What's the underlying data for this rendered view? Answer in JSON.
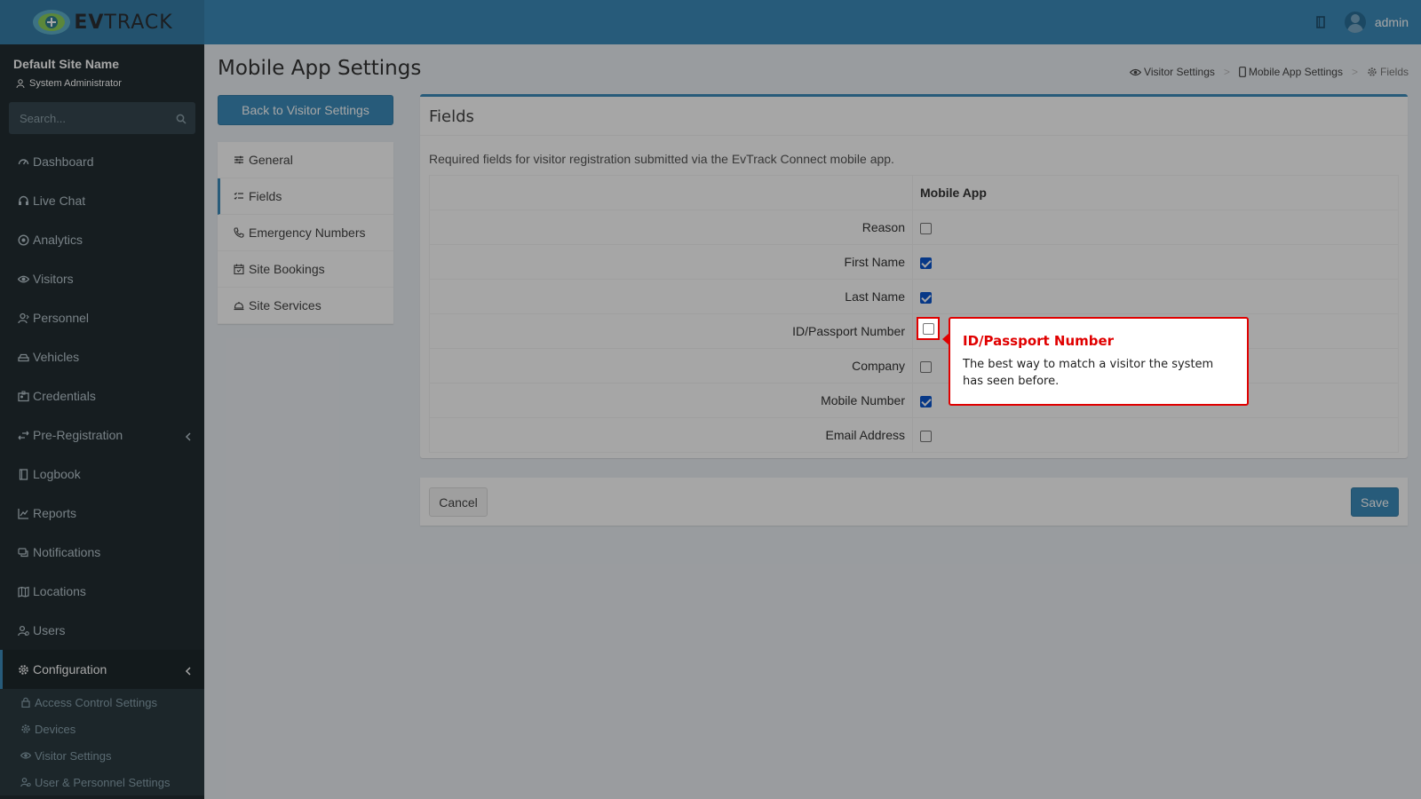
{
  "header": {
    "logo_text_bold": "EV",
    "logo_text": "TRACK",
    "user_name": "admin"
  },
  "sidebar": {
    "site_name": "Default Site Name",
    "role": "System Administrator",
    "search_placeholder": "Search...",
    "items": [
      {
        "label": "Dashboard",
        "icon": "dashboard-icon"
      },
      {
        "label": "Live Chat",
        "icon": "headset-icon"
      },
      {
        "label": "Analytics",
        "icon": "target-icon"
      },
      {
        "label": "Visitors",
        "icon": "eye-icon"
      },
      {
        "label": "Personnel",
        "icon": "user-tie-icon"
      },
      {
        "label": "Vehicles",
        "icon": "car-icon"
      },
      {
        "label": "Credentials",
        "icon": "id-card-icon"
      },
      {
        "label": "Pre-Registration",
        "icon": "exchange-icon"
      },
      {
        "label": "Logbook",
        "icon": "book-icon"
      },
      {
        "label": "Reports",
        "icon": "chart-icon"
      },
      {
        "label": "Notifications",
        "icon": "comments-icon"
      },
      {
        "label": "Locations",
        "icon": "map-icon"
      },
      {
        "label": "Users",
        "icon": "users-icon"
      },
      {
        "label": "Configuration",
        "icon": "cog-icon"
      }
    ],
    "sub_items": [
      {
        "label": "Access Control Settings",
        "icon": "lock-icon"
      },
      {
        "label": "Devices",
        "icon": "gear-icon"
      },
      {
        "label": "Visitor Settings",
        "icon": "eye-icon"
      },
      {
        "label": "User & Personnel Settings",
        "icon": "users-icon"
      }
    ]
  },
  "page": {
    "title": "Mobile App Settings",
    "breadcrumb": [
      "Visitor Settings",
      "Mobile App Settings",
      "Fields"
    ],
    "back_button": "Back to Visitor Settings"
  },
  "settings_menu": [
    "General",
    "Fields",
    "Emergency Numbers",
    "Site Bookings",
    "Site Services"
  ],
  "fields_box": {
    "title": "Fields",
    "description": "Required fields for visitor registration submitted via the EvTrack Connect mobile app.",
    "column_header": "Mobile App",
    "rows": [
      {
        "label": "Reason",
        "checked": false
      },
      {
        "label": "First Name",
        "checked": true
      },
      {
        "label": "Last Name",
        "checked": true
      },
      {
        "label": "ID/Passport Number",
        "checked": false
      },
      {
        "label": "Company",
        "checked": false
      },
      {
        "label": "Mobile Number",
        "checked": true
      },
      {
        "label": "Email Address",
        "checked": false
      }
    ]
  },
  "actions": {
    "cancel": "Cancel",
    "save": "Save"
  },
  "tour_tooltip": {
    "title": "ID/Passport Number",
    "body": "The best way to match a visitor the system has seen before."
  },
  "colors": {
    "primary": "#3c8dbc",
    "sidebar_bg": "#222d32",
    "highlight_red": "#e00000",
    "checkbox_blue": "#0b57d0"
  }
}
